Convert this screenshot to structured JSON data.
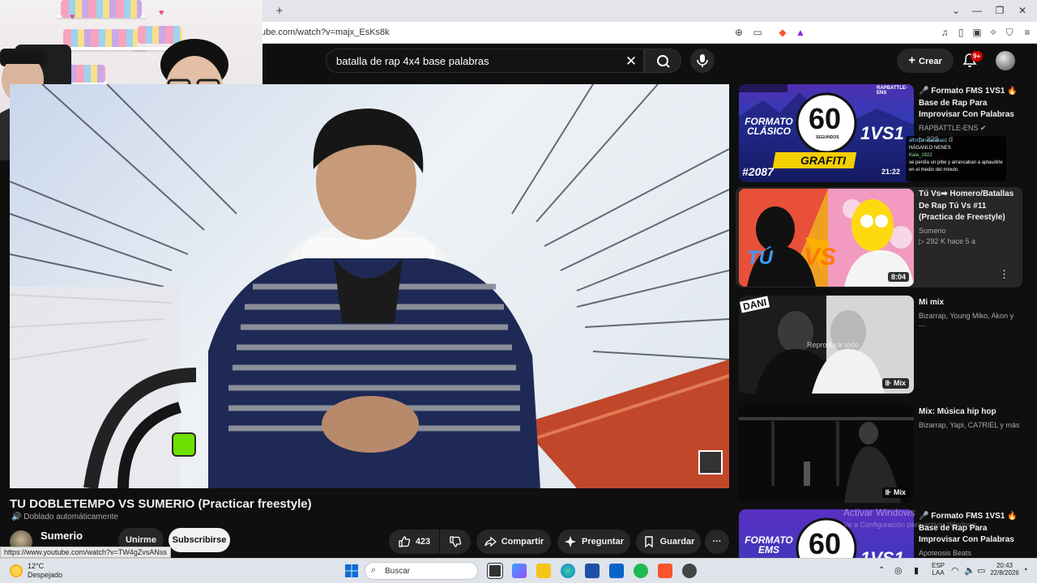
{
  "browser": {
    "url": "ube.com/watch?v=majx_EsKs8k",
    "new_tab_symbol": "+",
    "status_url": "https://www.youtube.com/watch?v=TW4gZvsANss"
  },
  "header": {
    "search_query": "batalla de rap 4x4 base palabras",
    "create_label": "Crear",
    "notification_badge": "9+"
  },
  "video": {
    "title": "TU DOBLETEMPO VS SUMERIO (Practicar freestyle)",
    "dubbed_label": "Doblado automáticamente",
    "channel_name": "Sumerio",
    "join_label": "Unirme",
    "subscribe_label": "Subscribirse",
    "like_count": "423",
    "share_label": "Compartir",
    "ask_label": "Preguntar",
    "save_label": "Guardar",
    "more_label": "···"
  },
  "sidebar": {
    "items": [
      {
        "title": "🎤 Formato FMS 1VS1 🔥 Base de Rap Para Improvisar Con Palabras ...",
        "channel": "RAPBATTLE-ENS",
        "meta": "▷ 223 ... d",
        "thumb_text_main": "60",
        "thumb_text_sub": "SEGUNDOS",
        "thumb_label_left": "FORMATO CLÁSICO",
        "thumb_label_right": "1VS1",
        "thumb_label_bottom": "GRAFITI",
        "thumb_number": "#2087",
        "thumb_brand": "RAPBATTLE-ENS",
        "chat_1": "alfonfandeeliaan1",
        "chat_2": "HÁGANLO NENES",
        "chat_3": "Kala_1922",
        "chat_4": "se perdía un pibe y arrancaban a aplaudirle en el medio del minuto",
        "thumb_time": "21:22"
      },
      {
        "title": "Tú Vs➡ Homero/Batallas De Rap Tú Vs #11 (Practica de Freestyle)",
        "channel": "Sumerio",
        "meta": "▷ 292 K   hace 5 a",
        "thumb_text_main": "TÚ",
        "thumb_text_sub": "VS",
        "duration": "8:04"
      },
      {
        "title": "Mi mix",
        "channel": "Bizarrap, Young Miko, Akon y ...",
        "thumb_overlay": "Reproducir todo",
        "thumb_corner": "DANI",
        "mix_label": "Mix"
      },
      {
        "title": "Mix: Música hip hop",
        "channel": "Bizarrap, Yapi, CA7RIEL y más",
        "mix_label": "Mix"
      },
      {
        "title": "🎤 Formato FMS 1VS1 🔥 Base de Rap Para Improvisar Con Palabras ...",
        "channel": "Apoteosis Beats",
        "thumb_text_main": "60",
        "thumb_label_left": "FORMATO EMS",
        "thumb_label_right": "1VS1"
      }
    ]
  },
  "watermark": {
    "line1": "Activar Windows",
    "line2": "Ve a Configuración para activar Windows."
  },
  "taskbar": {
    "temperature": "12°C",
    "weather": "Despejado",
    "search_placeholder": "Buscar",
    "lang_1": "ESP",
    "lang_2": "LAA",
    "time": "20:43",
    "date": "22/8/2026"
  },
  "colors": {
    "youtube_bg": "#0f0f0f",
    "badge_red": "#cc0000",
    "pill_bg": "#272727"
  }
}
